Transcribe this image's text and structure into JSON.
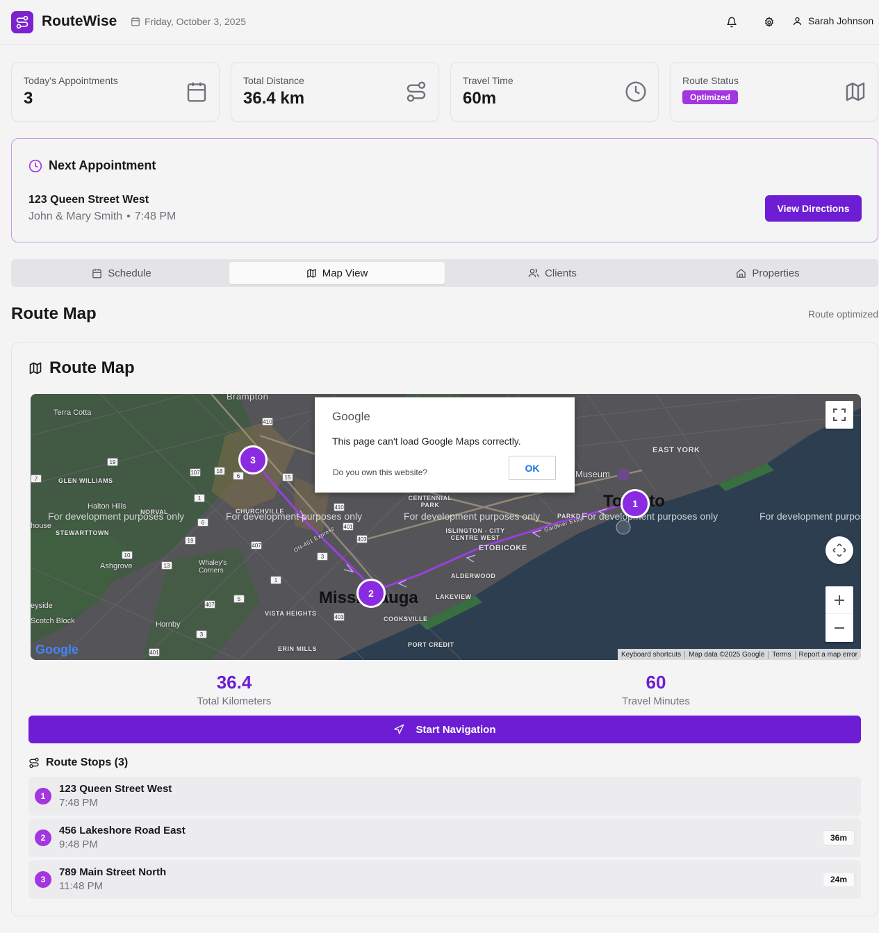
{
  "header": {
    "app_title": "RouteWise",
    "date": "Friday, October 3, 2025",
    "user_name": "Sarah Johnson"
  },
  "stats": [
    {
      "label": "Today's Appointments",
      "value": "3",
      "icon": "calendar-icon"
    },
    {
      "label": "Total Distance",
      "value": "36.4 km",
      "icon": "route-icon"
    },
    {
      "label": "Travel Time",
      "value": "60m",
      "icon": "clock-icon"
    },
    {
      "label": "Route Status",
      "badge": "Optimized",
      "icon": "map-icon"
    }
  ],
  "next_appointment": {
    "title": "Next Appointment",
    "address": "123 Queen Street West",
    "clients": "John & Mary Smith",
    "separator": "•",
    "time": "7:48 PM",
    "button_label": "View Directions"
  },
  "tabs": [
    {
      "label": "Schedule",
      "icon": "calendar-icon"
    },
    {
      "label": "Map View",
      "icon": "map-icon",
      "active": true
    },
    {
      "label": "Clients",
      "icon": "users-icon"
    },
    {
      "label": "Properties",
      "icon": "home-icon"
    }
  ],
  "section": {
    "title": "Route Map",
    "status": "Route optimized"
  },
  "map_card": {
    "title": "Route Map",
    "map": {
      "dev_watermark": "For development purposes only",
      "dialog": {
        "brand": "Google",
        "message": "This page can't load Google Maps correctly.",
        "question": "Do you own this website?",
        "ok_label": "OK"
      },
      "places": {
        "brampton": "Brampton",
        "terra_cotta": "Terra Cotta",
        "glen_williams": "GLEN WILLIAMS",
        "halton_hills": "Halton Hills",
        "norval": "NORVAL",
        "house": "house",
        "stewarttown": "STEWARTTOWN",
        "ashgrove": "Ashgrove",
        "whaleys": "Whaley's Corners",
        "churchville": "CHURCHVILLE",
        "centennial": "CENTENNIAL PARK",
        "islington": "ISLINGTON - CITY CENTRE WEST",
        "etobicoke": "ETOBICOKE",
        "alderwood": "ALDERWOOD",
        "lakeview": "LAKEVIEW",
        "vista": "VISTA HEIGHTS",
        "cooksville": "COOKSVILLE",
        "port_credit": "PORT CREDIT",
        "erin_mills": "ERIN MILLS",
        "hornby": "Hornby",
        "eyside": "eyside",
        "scotch_block": "Scotch Block",
        "east_york": "EAST YORK",
        "museum": "Museum",
        "toronto": "Toronto",
        "mississauga": "Mississauga",
        "parkd": "PARKD",
        "hwy401": "ON-401 Express",
        "gardiner": "Gardiner Expy"
      },
      "highways": [
        "410",
        "19",
        "107",
        "18",
        "6",
        "15",
        "1",
        "410",
        "401",
        "6",
        "19",
        "407",
        "403",
        "10",
        "13",
        "1",
        "3",
        "5",
        "407",
        "403",
        "3",
        "401",
        "7"
      ],
      "google_logo": "Google",
      "attribution": [
        "Keyboard shortcuts",
        "Map data ©2025 Google",
        "Terms",
        "Report a map error"
      ],
      "markers": [
        "1",
        "2",
        "3"
      ]
    },
    "metrics": [
      {
        "value": "36.4",
        "label": "Total Kilometers"
      },
      {
        "value": "60",
        "label": "Travel Minutes"
      }
    ],
    "start_button": "Start Navigation",
    "stops_title": "Route Stops (3)",
    "stops": [
      {
        "num": "1",
        "address": "123 Queen Street West",
        "time": "7:48 PM",
        "duration": ""
      },
      {
        "num": "2",
        "address": "456 Lakeshore Road East",
        "time": "9:48 PM",
        "duration": "36m"
      },
      {
        "num": "3",
        "address": "789 Main Street North",
        "time": "11:48 PM",
        "duration": "24m"
      }
    ]
  },
  "colors": {
    "brand": "#7c22ce",
    "button": "#6d1ed4",
    "badge": "#a336e0",
    "marker": "#8a2be2"
  }
}
